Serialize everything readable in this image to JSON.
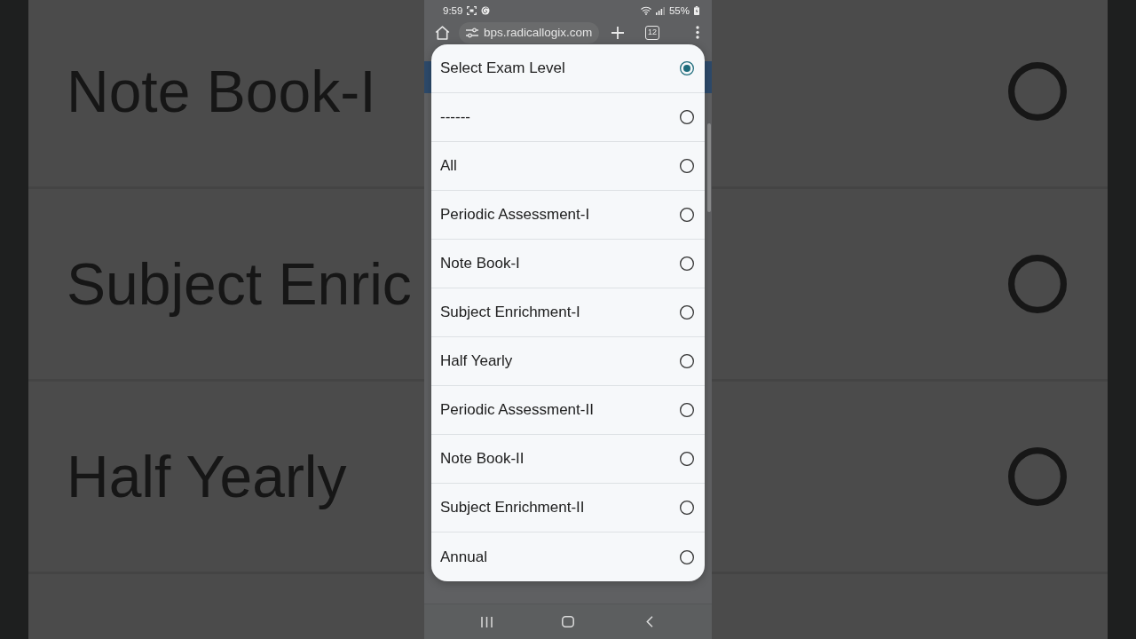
{
  "backdrop": {
    "rows": [
      {
        "label": "Note Book-I",
        "selected": false
      },
      {
        "label": "Subject Enric",
        "selected": false
      },
      {
        "label": "Half Yearly",
        "selected": false
      }
    ]
  },
  "phone": {
    "status_bar": {
      "time": "9:59",
      "battery": "55%"
    },
    "browser": {
      "url": "bps.radicallogix.com",
      "tab_count": "12"
    },
    "dialog": {
      "options": [
        {
          "label": "Select Exam Level",
          "selected": true
        },
        {
          "label": "------",
          "selected": false
        },
        {
          "label": "All",
          "selected": false
        },
        {
          "label": "Periodic Assessment-I",
          "selected": false
        },
        {
          "label": "Note Book-I",
          "selected": false
        },
        {
          "label": "Subject Enrichment-I",
          "selected": false
        },
        {
          "label": "Half Yearly",
          "selected": false
        },
        {
          "label": "Periodic Assessment-II",
          "selected": false
        },
        {
          "label": "Note Book-II",
          "selected": false
        },
        {
          "label": "Subject Enrichment-II",
          "selected": false
        },
        {
          "label": "Annual",
          "selected": false
        }
      ]
    }
  }
}
